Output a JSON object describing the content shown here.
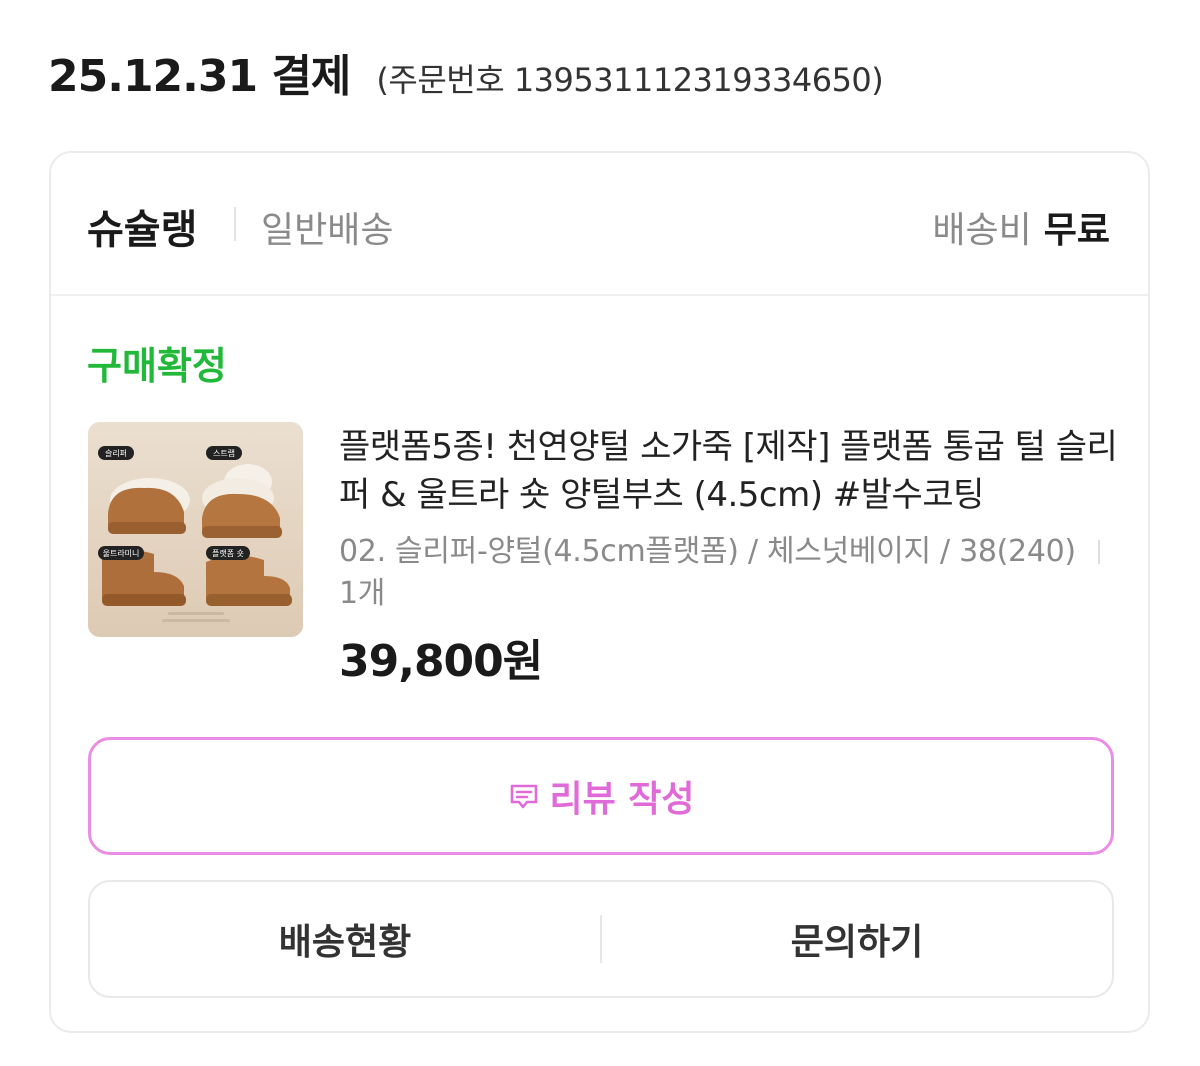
{
  "order": {
    "date_label": "25.12.31 결제",
    "number_label": "(주문번호 13953111231​9334650)"
  },
  "seller": {
    "name": "슈슐랭",
    "delivery_type": "일반배송",
    "shipping_fee_label": "배송비",
    "shipping_fee_value": "무료"
  },
  "status": {
    "text": "구매확정",
    "color": "#22b93a"
  },
  "product": {
    "thumbnail_labels": [
      "슬리퍼",
      "스트랩",
      "울트라미니",
      "플랫폼 숏"
    ],
    "title": "플랫폼5종! 천연양털 소가죽 [제작] 플랫폼 통굽 털 슬리퍼 & 울트라 숏 양털부츠 (4.5cm) #발수코팅",
    "option": "02. 슬리퍼-양털(4.5cm플랫폼) / 체스넛베이지 / 38(240)",
    "quantity": "1개",
    "price": "39,800원"
  },
  "buttons": {
    "review": "리뷰 작성",
    "delivery_status": "배송현황",
    "inquiry": "문의하기"
  },
  "colors": {
    "accent_pink": "#e06ad8",
    "status_green": "#22b93a"
  },
  "icons": {
    "review": "chat-bubble-icon"
  }
}
